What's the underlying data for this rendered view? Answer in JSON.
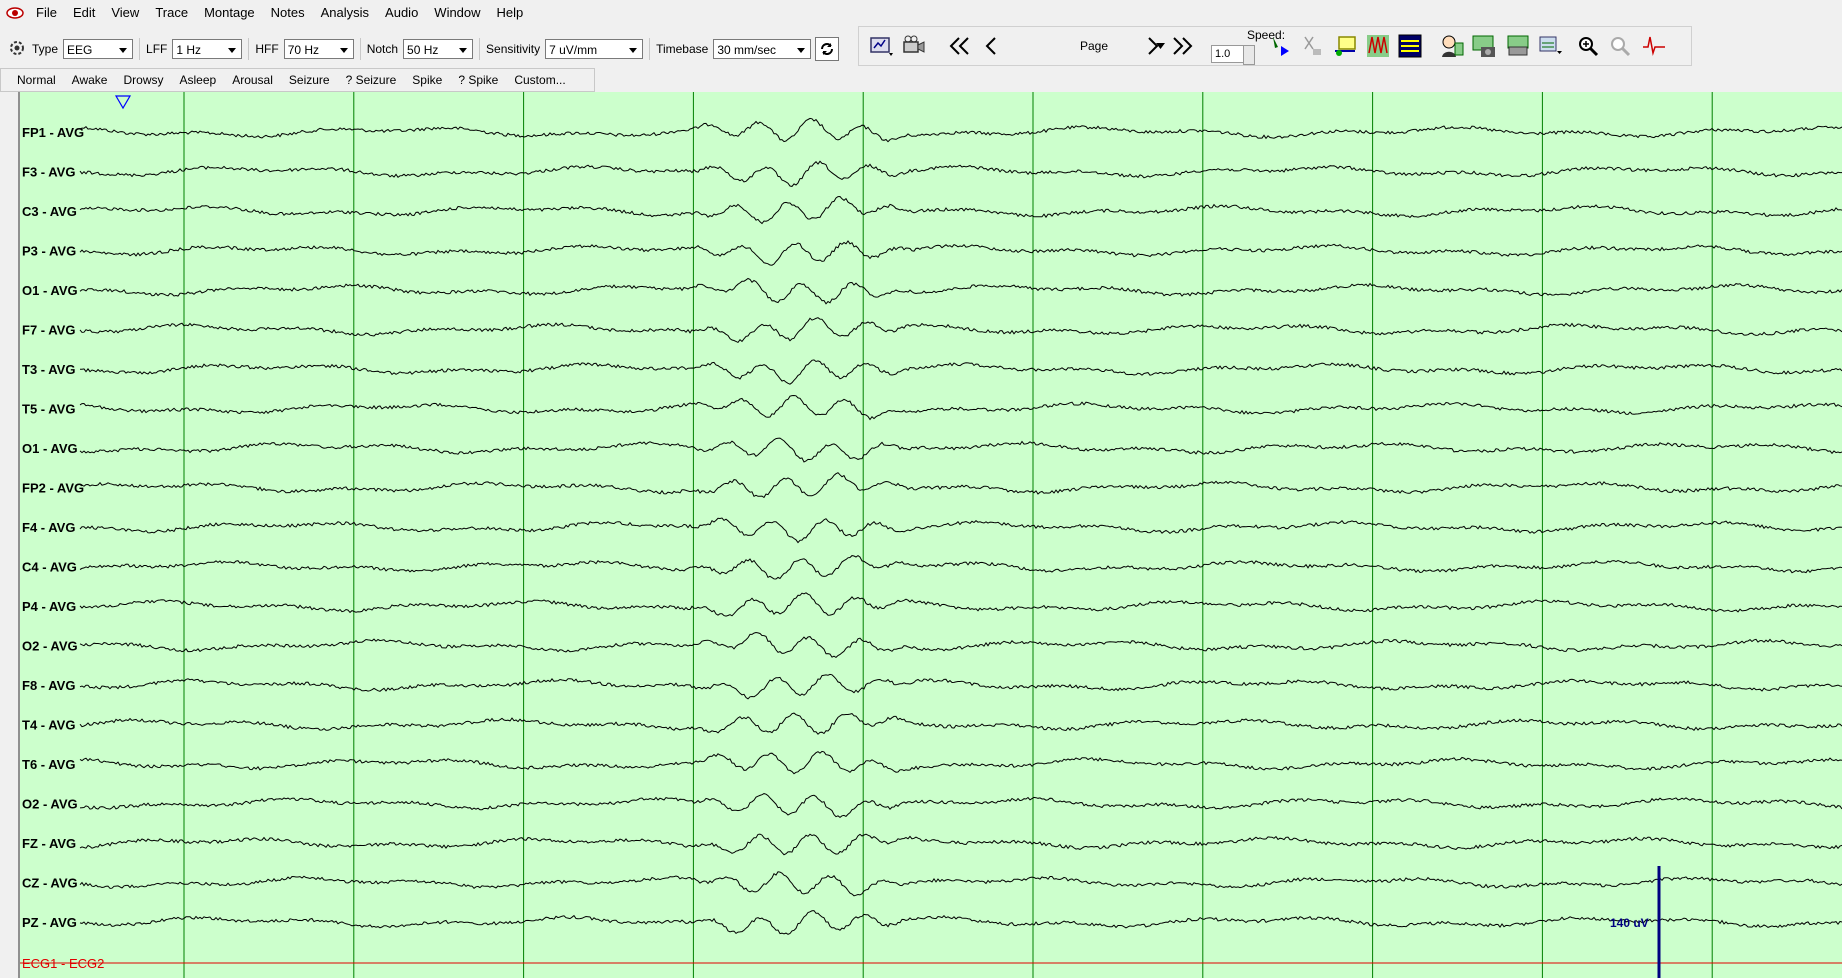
{
  "menu": [
    "File",
    "Edit",
    "View",
    "Trace",
    "Montage",
    "Notes",
    "Analysis",
    "Audio",
    "Window",
    "Help"
  ],
  "toolbar": {
    "type_label": "Type",
    "type_value": "EEG",
    "lff_label": "LFF",
    "lff_value": "1 Hz",
    "hff_label": "HFF",
    "hff_value": "70 Hz",
    "notch_label": "Notch",
    "notch_value": "50 Hz",
    "sensitivity_label": "Sensitivity",
    "sensitivity_value": "7 uV/mm",
    "timebase_label": "Timebase",
    "timebase_value": "30 mm/sec"
  },
  "playback": {
    "page_label": "Page",
    "speed_label": "Speed:",
    "speed_value": "1.0"
  },
  "annotations": [
    "Normal",
    "Awake",
    "Drowsy",
    "Asleep",
    "Arousal",
    "Seizure",
    "? Seizure",
    "Spike",
    "? Spike",
    "Custom..."
  ],
  "channels": [
    "FP1 - AVG",
    "F3 - AVG",
    "C3 - AVG",
    "P3 - AVG",
    "O1 - AVG",
    "F7 - AVG",
    "T3 - AVG",
    "T5 - AVG",
    "O1 - AVG",
    "FP2 - AVG",
    "F4 - AVG",
    "C4 - AVG",
    "P4 - AVG",
    "O2 - AVG",
    "F8 - AVG",
    "T4 - AVG",
    "T6 - AVG",
    "O2 - AVG",
    "FZ - AVG",
    "CZ - AVG",
    "PZ - AVG"
  ],
  "ecg_channel": "ECG1 - ECG2",
  "calibration_label": "140 uV",
  "colors": {
    "background": "#ccffcc",
    "gridline": "#008000",
    "trace": "#000000",
    "ecg": "#e00000",
    "calibration": "#000080"
  }
}
